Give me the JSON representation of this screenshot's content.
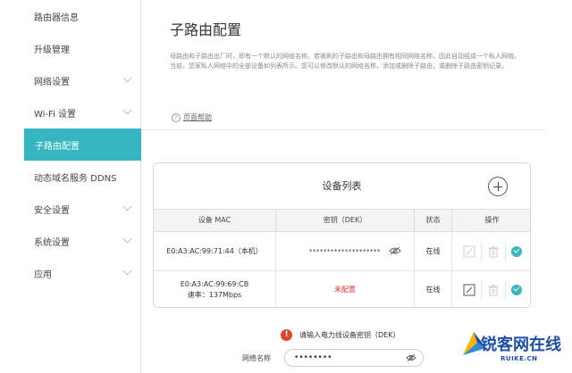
{
  "sidebar": {
    "items": [
      {
        "label": "路由器信息",
        "expandable": false
      },
      {
        "label": "升级管理",
        "expandable": false
      },
      {
        "label": "网络设置",
        "expandable": true
      },
      {
        "label": "Wi-Fi 设置",
        "expandable": true
      },
      {
        "label": "子路由配置",
        "expandable": false,
        "active": true
      },
      {
        "label": "动态域名服务 DDNS",
        "expandable": false
      },
      {
        "label": "安全设置",
        "expandable": true
      },
      {
        "label": "系统设置",
        "expandable": true
      },
      {
        "label": "应用",
        "expandable": true
      }
    ]
  },
  "main": {
    "title": "子路由配置",
    "description": "母路由和子路由出厂时，即有一个默认的网络名称。若被刷的子路由和母路由拥有相同网络名称，因此自动组成一个私人网络。当前，您家私人网络中的全部设备如列表所示。您可以修改默认的网络名称，添加或删除子路由，或删除子路由密钥记录。",
    "help_label": "页面帮助",
    "help_icon_glyph": "?"
  },
  "device_table": {
    "title": "设备列表",
    "columns": [
      "设备 MAC",
      "密钥（DEK）",
      "状态",
      "操作"
    ],
    "rows": [
      {
        "mac": "E0:A3:AC:99:71:44（本机）",
        "speed": "",
        "dek": "********************",
        "dek_set": true,
        "status": "在线"
      },
      {
        "mac": "E0:A3:AC:99:69:CB",
        "speed": "速率：137Mbps",
        "dek": "未配置",
        "dek_set": false,
        "status": "在线"
      }
    ]
  },
  "form": {
    "warning": "请输入电力线设备密钥（DEK）",
    "warning_icon_glyph": "!",
    "network_name_label": "网络名称",
    "network_name_value": "••••••••"
  },
  "watermark": {
    "brand": "锐客网在线",
    "url": "RUIKE.CN"
  },
  "colors": {
    "accent": "#36b6c0",
    "warning": "#e0462d",
    "unset_text": "#dd3333"
  },
  "icons": {
    "add": "plus-circle-icon",
    "reveal": "eye-slash-icon",
    "edit": "edit-icon",
    "delete": "trash-icon",
    "confirm": "check-circle-icon"
  }
}
